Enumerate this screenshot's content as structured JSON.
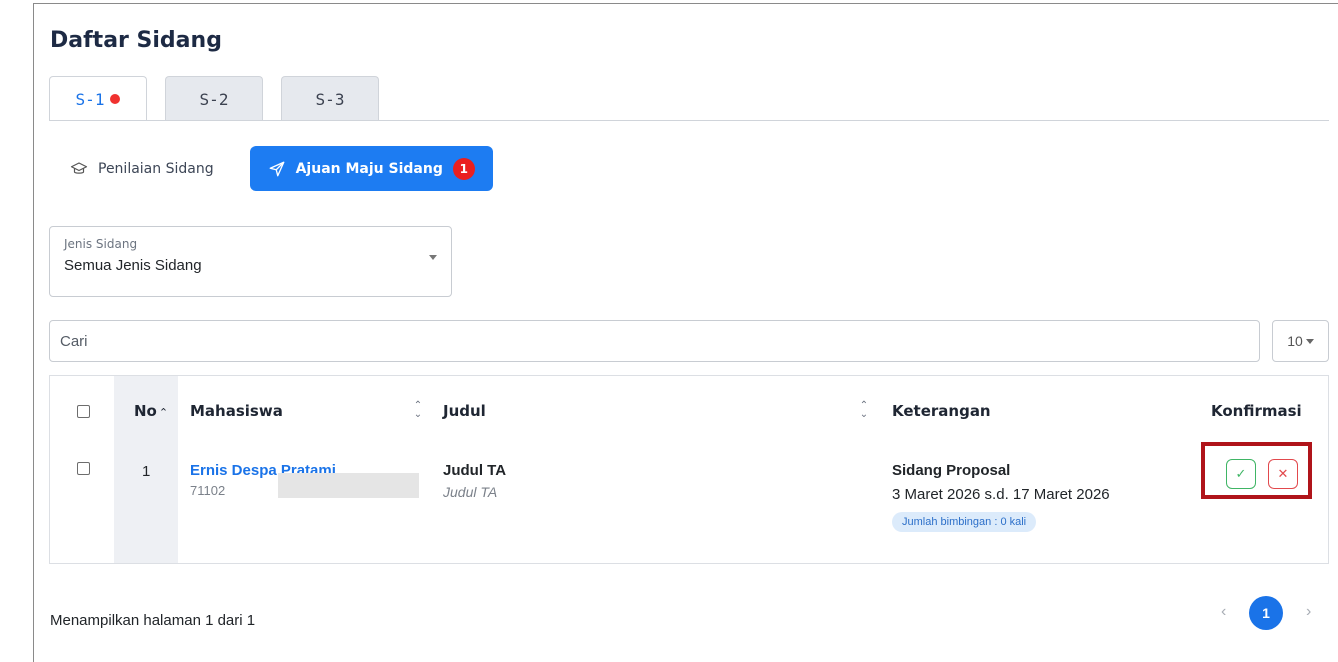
{
  "page": {
    "title": "Daftar Sidang"
  },
  "tabs": [
    {
      "label": "S-1",
      "active": true,
      "has_dot": true
    },
    {
      "label": "S-2",
      "active": false
    },
    {
      "label": "S-3",
      "active": false
    }
  ],
  "subnav": {
    "penilaian": {
      "label": "Penilaian Sidang",
      "icon": "graduation-cap-icon"
    },
    "ajuan": {
      "label": "Ajuan Maju Sidang",
      "icon": "paper-plane-icon",
      "badge": "1"
    }
  },
  "filter": {
    "label": "Jenis Sidang",
    "value": "Semua Jenis Sidang"
  },
  "search": {
    "placeholder": "Cari"
  },
  "page_size": {
    "value": "10"
  },
  "table": {
    "headers": {
      "no": "No",
      "mahasiswa": "Mahasiswa",
      "judul": "Judul",
      "keterangan": "Keterangan",
      "konfirmasi": "Konfirmasi"
    },
    "rows": [
      {
        "no": "1",
        "name": "Ernis Despa Pratami",
        "nim": "71102",
        "judul_title": "Judul TA",
        "judul_sub": "Judul TA",
        "jenis": "Sidang Proposal",
        "tanggal": "3 Maret 2026 s.d. 17 Maret 2026",
        "bimbingan": "Jumlah bimbingan : 0 kali"
      }
    ]
  },
  "actions": {
    "approve_icon": "check-icon",
    "reject_icon": "close-icon"
  },
  "footer": {
    "info": "Menampilkan halaman 1 dari 1"
  },
  "pagination": {
    "current": "1"
  },
  "colors": {
    "primary": "#1a73e8",
    "badge_red": "#ea1f1f",
    "success": "#3fb565",
    "danger": "#e2494d",
    "highlight": "#b0141a"
  }
}
